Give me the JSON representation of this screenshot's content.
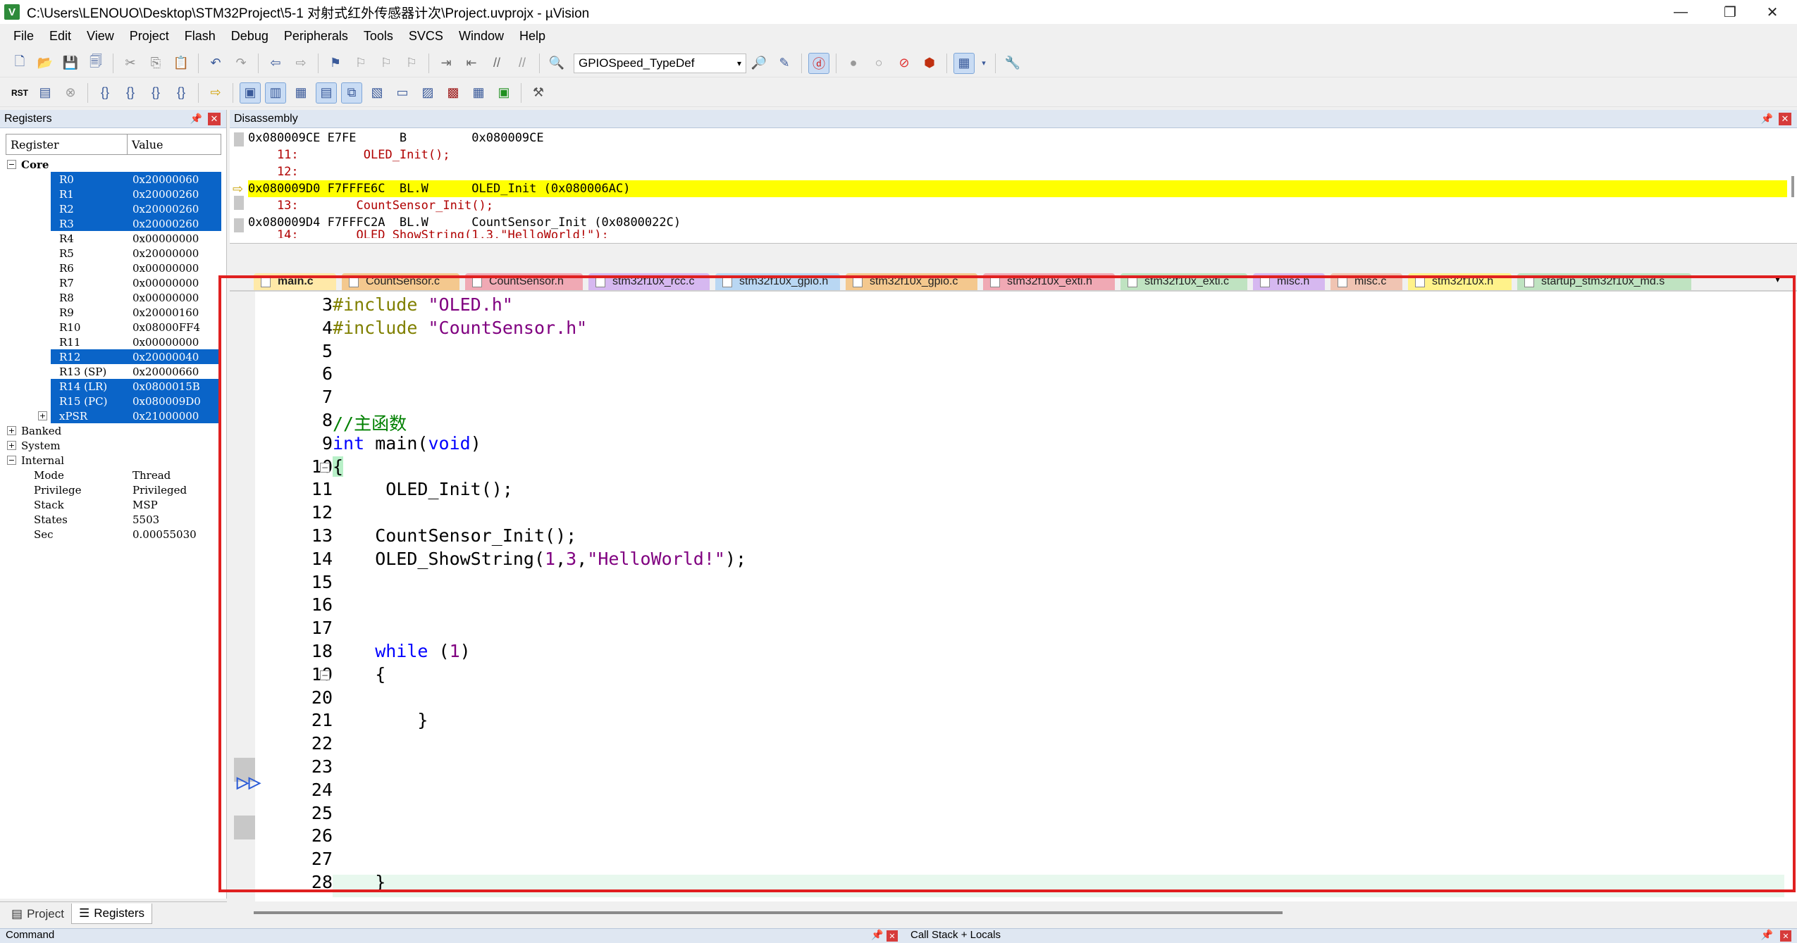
{
  "window": {
    "title": "C:\\Users\\LENOUO\\Desktop\\STM32Project\\5-1 对射式红外传感器计次\\Project.uvprojx - µVision",
    "icon_letter": "V",
    "minimize": "—",
    "maximize": "❐",
    "close": "✕"
  },
  "menu": [
    "File",
    "Edit",
    "View",
    "Project",
    "Flash",
    "Debug",
    "Peripherals",
    "Tools",
    "SVCS",
    "Window",
    "Help"
  ],
  "toolbar": {
    "target_combo": "GPIOSpeed_TypeDef",
    "icons": [
      "new-file-icon",
      "open-folder-icon",
      "save-icon",
      "save-all-icon",
      "cut-icon",
      "copy-icon",
      "paste-icon",
      "undo-icon",
      "redo-icon",
      "back-icon",
      "forward-icon",
      "bookmark-icon",
      "indent-icon",
      "outdent-icon",
      "find-icon",
      "debug-icon",
      "breakpoint-icon",
      "settings-icon"
    ]
  },
  "debug_toolbar": {
    "rst_label": "RST"
  },
  "registers_panel": {
    "title": "Registers",
    "col_register": "Register",
    "col_value": "Value",
    "core_label": "Core",
    "rows": [
      {
        "name": "R0",
        "value": "0x20000060",
        "selected": true
      },
      {
        "name": "R1",
        "value": "0x20000260",
        "selected": true
      },
      {
        "name": "R2",
        "value": "0x20000260",
        "selected": true
      },
      {
        "name": "R3",
        "value": "0x20000260",
        "selected": true
      },
      {
        "name": "R4",
        "value": "0x00000000",
        "selected": false
      },
      {
        "name": "R5",
        "value": "0x20000000",
        "selected": false
      },
      {
        "name": "R6",
        "value": "0x00000000",
        "selected": false
      },
      {
        "name": "R7",
        "value": "0x00000000",
        "selected": false
      },
      {
        "name": "R8",
        "value": "0x00000000",
        "selected": false
      },
      {
        "name": "R9",
        "value": "0x20000160",
        "selected": false
      },
      {
        "name": "R10",
        "value": "0x08000FF4",
        "selected": false
      },
      {
        "name": "R11",
        "value": "0x00000000",
        "selected": false
      },
      {
        "name": "R12",
        "value": "0x20000040",
        "selected": true
      },
      {
        "name": "R13 (SP)",
        "value": "0x20000660",
        "selected": false
      },
      {
        "name": "R14 (LR)",
        "value": "0x0800015B",
        "selected": true
      },
      {
        "name": "R15 (PC)",
        "value": "0x080009D0",
        "selected": true
      },
      {
        "name": "xPSR",
        "value": "0x21000000",
        "selected": true
      }
    ],
    "groups": [
      "Banked",
      "System",
      "Internal"
    ],
    "internal": [
      {
        "name": "Mode",
        "value": "Thread"
      },
      {
        "name": "Privilege",
        "value": "Privileged"
      },
      {
        "name": "Stack",
        "value": "MSP"
      },
      {
        "name": "States",
        "value": "5503"
      },
      {
        "name": "Sec",
        "value": "0.00055030"
      }
    ],
    "tab_project": "Project",
    "tab_registers": "Registers"
  },
  "disassembly": {
    "title": "Disassembly",
    "lines": [
      "0x080009CE E7FE      B         0x080009CE",
      "    11:         OLED_Init();",
      "    12:",
      "0x080009D0 F7FFFE6C  BL.W      OLED_Init (0x080006AC)",
      "    13:        CountSensor_Init();",
      "0x080009D4 F7FFFC2A  BL.W      CountSensor_Init (0x0800022C)",
      "    14:        OLED_ShowString(1,3,\"HelloWorld!\");"
    ]
  },
  "file_tabs": [
    {
      "label": "main.c",
      "color": "#ffd98a"
    },
    {
      "label": "CountSensor.c",
      "color": "#f4c88e"
    },
    {
      "label": "CountSensor.h",
      "color": "#f0a9b4"
    },
    {
      "label": "stm32f10x_rcc.c",
      "color": "#d6b8f0"
    },
    {
      "label": "stm32f10x_gpio.h",
      "color": "#b9d7f3"
    },
    {
      "label": "stm32f10x_gpio.c",
      "color": "#f4c88e"
    },
    {
      "label": "stm32f10x_exti.h",
      "color": "#f0a9b4"
    },
    {
      "label": "stm32f10x_exti.c",
      "color": "#bfe3c1"
    },
    {
      "label": "misc.h",
      "color": "#d6b8f0"
    },
    {
      "label": "misc.c",
      "color": "#f0c4b2"
    },
    {
      "label": "stm32f10x.h",
      "color": "#fff28a"
    },
    {
      "label": "startup_stm32f10x_md.s",
      "color": "#bfe3c1"
    }
  ],
  "editor": {
    "line_numbers": [
      "3",
      "4",
      "5",
      "6",
      "7",
      "8",
      "9",
      "10",
      "11",
      "12",
      "13",
      "14",
      "15",
      "16",
      "17",
      "18",
      "19",
      "20",
      "21",
      "22",
      "23",
      "24",
      "25",
      "26",
      "27",
      "28"
    ],
    "code": {
      "l3_pp": "#include ",
      "l3_str": "\"OLED.h\"",
      "l4_pp": "#include ",
      "l4_str": "\"CountSensor.h\"",
      "l8_cm": "//主函数",
      "l9_kw1": "int",
      "l9_mid": " main(",
      "l9_kw2": "void",
      "l9_end": ")",
      "l10": "{",
      "l11": "     OLED_Init();",
      "l13": "    CountSensor_Init();",
      "l14_a": "    OLED_ShowString(",
      "l14_n1": "1",
      "l14_c": ",",
      "l14_n2": "3",
      "l14_c2": ",",
      "l14_str": "\"HelloWorld!\"",
      "l14_end": ");",
      "l18_kw": "    while",
      "l18_a": " (",
      "l18_num": "1",
      "l18_end": ")",
      "l19": "    {",
      "l21": "        }",
      "l28": "    }"
    }
  },
  "bottom": {
    "command": "Command",
    "callstack": "Call Stack + Locals"
  }
}
